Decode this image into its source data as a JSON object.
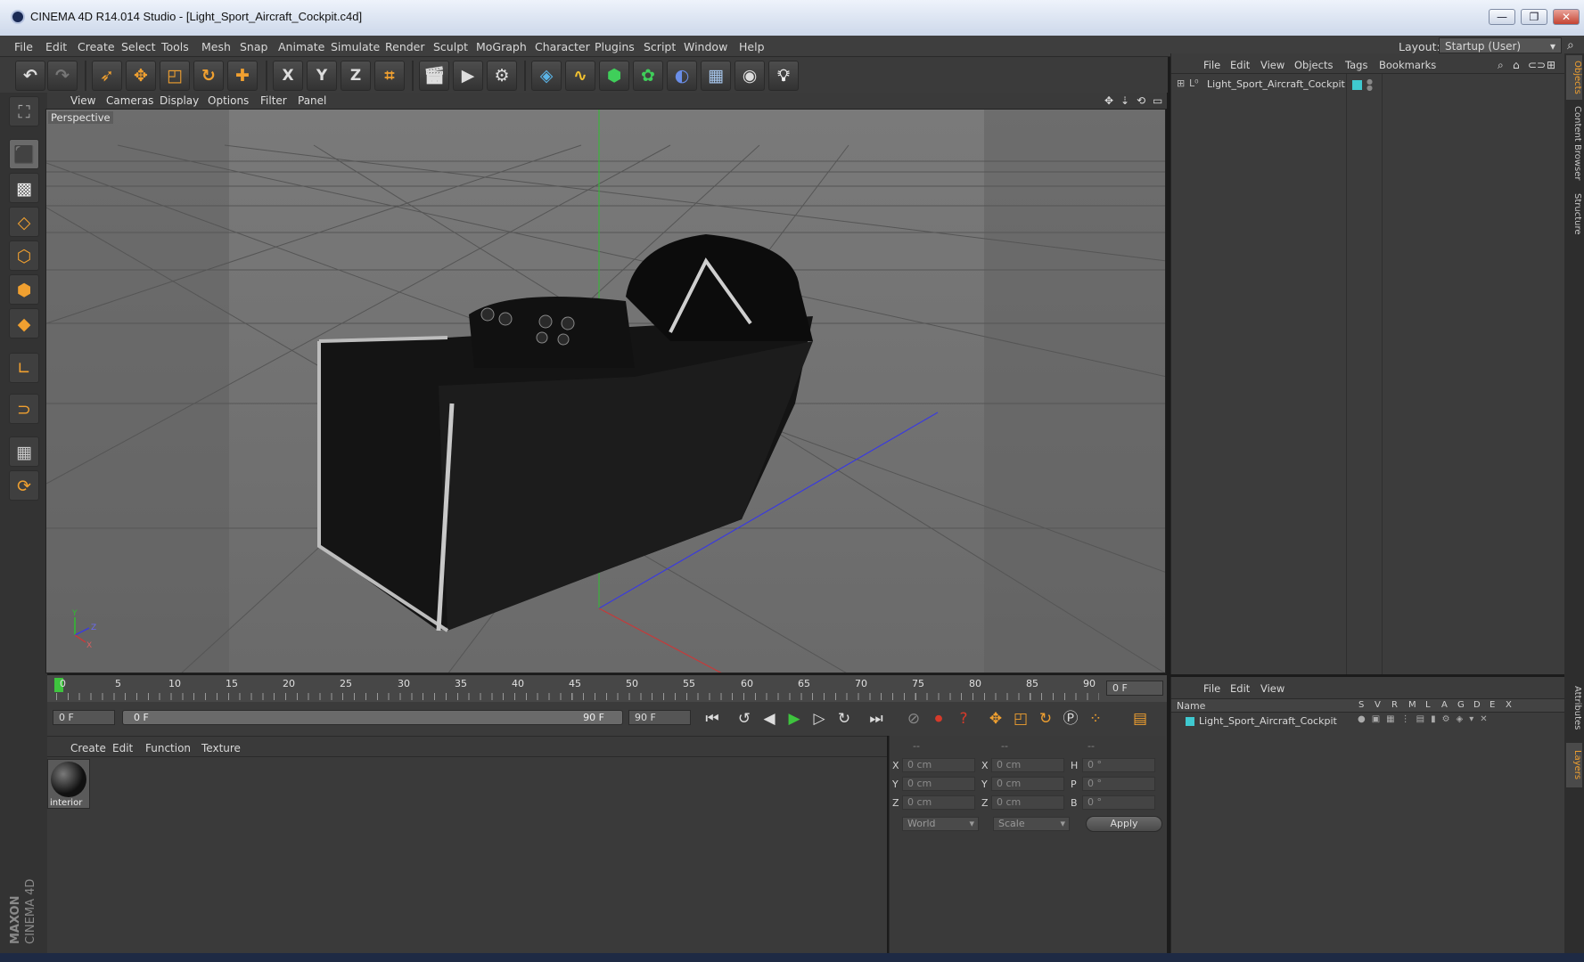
{
  "window": {
    "title": "CINEMA 4D R14.014 Studio - [Light_Sport_Aircraft_Cockpit.c4d]",
    "buttons": {
      "minimize": "—",
      "restore": "❐",
      "close": "✕"
    }
  },
  "menubar": {
    "items": [
      "File",
      "Edit",
      "Create",
      "Select",
      "Tools",
      "Mesh",
      "Snap",
      "Animate",
      "Simulate",
      "Render",
      "Sculpt",
      "MoGraph",
      "Character",
      "Plugins",
      "Script",
      "Window",
      "Help"
    ],
    "layout_label": "Layout:",
    "layout_value": "Startup (User)"
  },
  "toolbar": {
    "axis_labels": [
      "X",
      "Y",
      "Z"
    ]
  },
  "viewport": {
    "menu": [
      "View",
      "Cameras",
      "Display",
      "Options",
      "Filter",
      "Panel"
    ],
    "label": "Perspective",
    "axis": {
      "y": "Y",
      "z": "Z",
      "x": "X"
    }
  },
  "timeline": {
    "ticks": [
      "0",
      "5",
      "10",
      "15",
      "20",
      "25",
      "30",
      "35",
      "40",
      "45",
      "50",
      "55",
      "60",
      "65",
      "70",
      "75",
      "80",
      "85",
      "90"
    ],
    "current_frame": "0 F"
  },
  "transport": {
    "start_field": "0 F",
    "range_start": "0 F",
    "range_end": "90 F",
    "end_field": "90 F"
  },
  "material_panel": {
    "menu": [
      "Create",
      "Edit",
      "Function",
      "Texture"
    ],
    "materials": [
      {
        "name": "interior"
      }
    ]
  },
  "coord_panel": {
    "headers": [
      "--",
      "--",
      "--"
    ],
    "rows": [
      {
        "a": "X",
        "av": "0 cm",
        "b": "X",
        "bv": "0 cm",
        "c": "H",
        "cv": "0 °"
      },
      {
        "a": "Y",
        "av": "0 cm",
        "b": "Y",
        "bv": "0 cm",
        "c": "P",
        "cv": "0 °"
      },
      {
        "a": "Z",
        "av": "0 cm",
        "b": "Z",
        "bv": "0 cm",
        "c": "B",
        "cv": "0 °"
      }
    ],
    "mode1": "World",
    "mode2": "Scale",
    "apply": "Apply"
  },
  "object_panel": {
    "menu": [
      "File",
      "Edit",
      "View",
      "Objects",
      "Tags",
      "Bookmarks"
    ],
    "objects": [
      {
        "name": "Light_Sport_Aircraft_Cockpit"
      }
    ],
    "tag_color": "#3fc9d0"
  },
  "layer_panel": {
    "menu": [
      "File",
      "Edit",
      "View"
    ],
    "col_name": "Name",
    "columns": [
      "S",
      "V",
      "R",
      "M",
      "L",
      "A",
      "G",
      "D",
      "E",
      "X"
    ],
    "layers": [
      {
        "name": "Light_Sport_Aircraft_Cockpit"
      }
    ]
  },
  "side_tabs": [
    "Objects",
    "Content Browser",
    "Structure",
    "Attributes",
    "Layers"
  ],
  "branding": {
    "line1": "MAXON",
    "line2": "CINEMA 4D"
  },
  "colors": {
    "accent": "#f0a030",
    "green_play": "#3ec43e",
    "red_record": "#d63a2a"
  }
}
